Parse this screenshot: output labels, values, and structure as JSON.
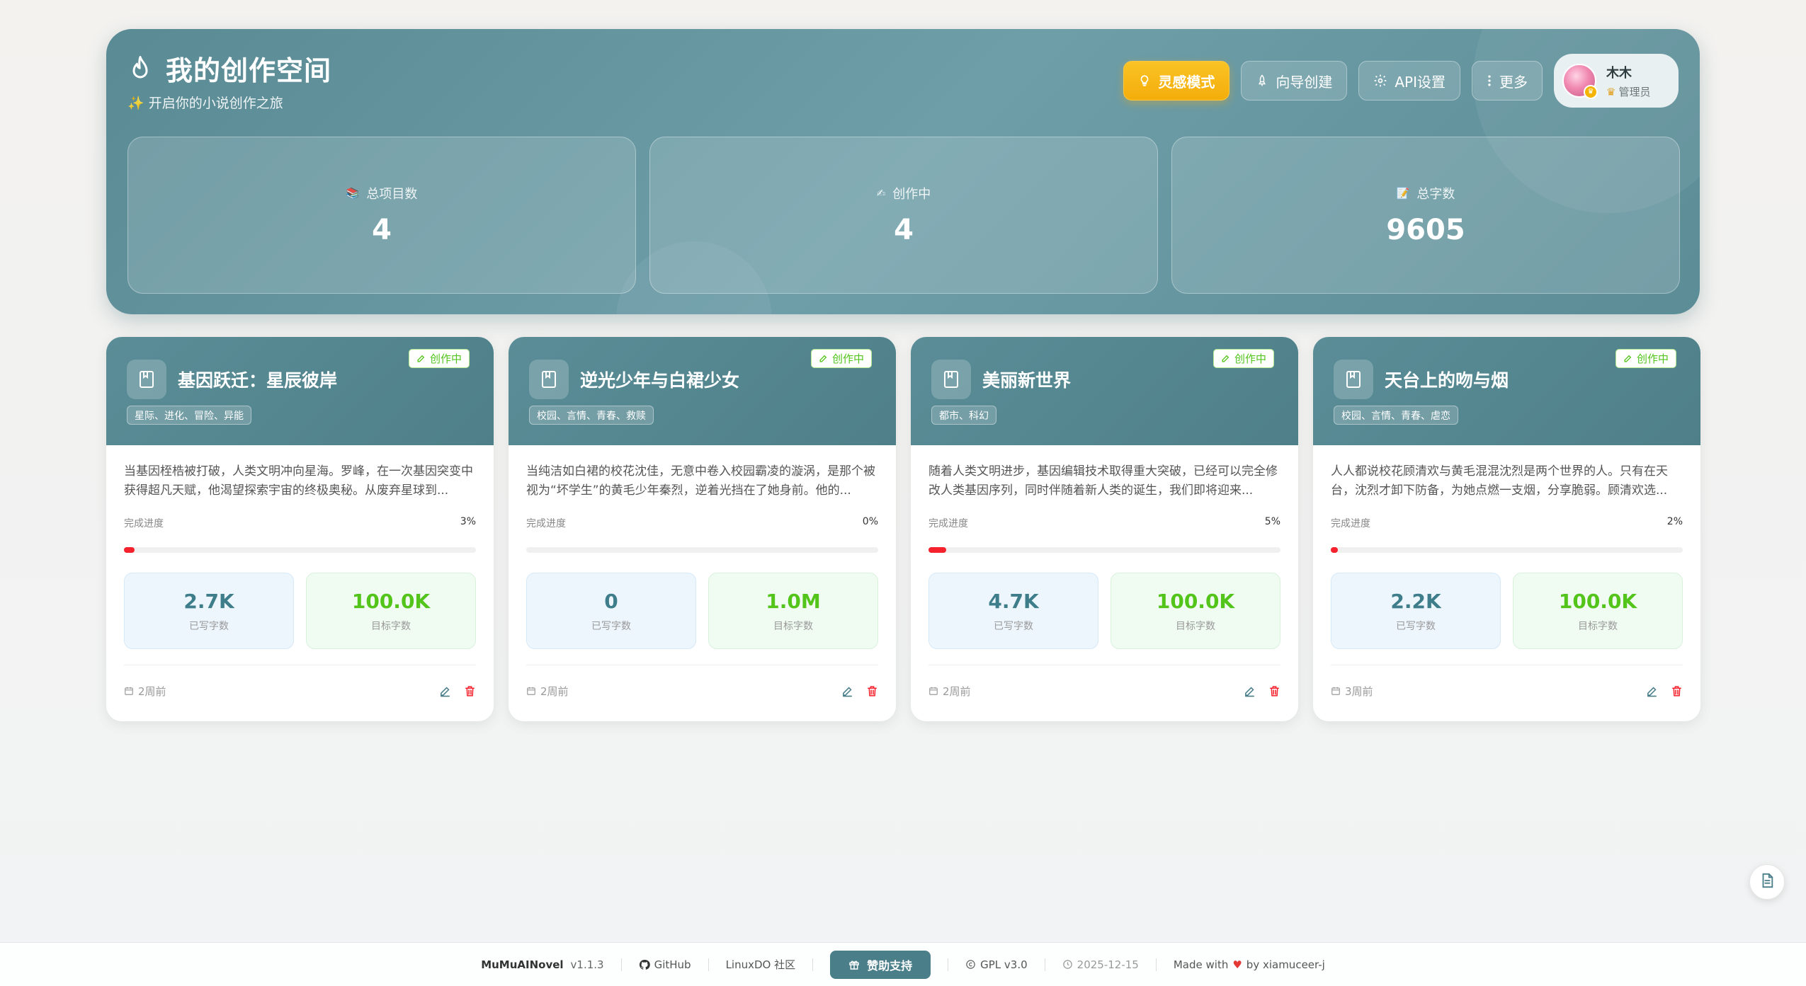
{
  "header": {
    "title": "我的创作空间",
    "subtitle": "✨ 开启你的小说创作之旅",
    "buttons": {
      "inspiration": "灵感模式",
      "wizard": "向导创建",
      "api": "API设置",
      "more": "更多"
    },
    "user": {
      "name": "木木",
      "role": "管理员"
    },
    "stats": [
      {
        "label": "总项目数",
        "value": "4"
      },
      {
        "label": "创作中",
        "value": "4"
      },
      {
        "label": "总字数",
        "value": "9605"
      }
    ]
  },
  "projects": [
    {
      "status": "创作中",
      "title": "基因跃迁：星辰彼岸",
      "tags": "星际、进化、冒险、异能",
      "desc": "当基因桎梏被打破，人类文明冲向星海。罗峰，在一次基因突变中获得超凡天赋，他渴望探索宇宙的终极奥秘。从废弃星球到...",
      "progress_label": "完成进度",
      "progress_pct": "3%",
      "progress": 0.03,
      "written": "2.7K",
      "written_label": "已写字数",
      "target": "100.0K",
      "target_label": "目标字数",
      "updated": "2周前"
    },
    {
      "status": "创作中",
      "title": "逆光少年与白裙少女",
      "tags": "校园、言情、青春、救赎",
      "desc": "当纯洁如白裙的校花沈佳，无意中卷入校园霸凌的漩涡，是那个被视为“坏学生”的黄毛少年秦烈，逆着光挡在了她身前。他的...",
      "progress_label": "完成进度",
      "progress_pct": "0%",
      "progress": 0.0,
      "written": "0",
      "written_label": "已写字数",
      "target": "1.0M",
      "target_label": "目标字数",
      "updated": "2周前"
    },
    {
      "status": "创作中",
      "title": "美丽新世界",
      "tags": "都市、科幻",
      "desc": "随着人类文明进步，基因编辑技术取得重大突破，已经可以完全修改人类基因序列，同时伴随着新人类的诞生，我们即将迎来...",
      "progress_label": "完成进度",
      "progress_pct": "5%",
      "progress": 0.05,
      "written": "4.7K",
      "written_label": "已写字数",
      "target": "100.0K",
      "target_label": "目标字数",
      "updated": "2周前"
    },
    {
      "status": "创作中",
      "title": "天台上的吻与烟",
      "tags": "校园、言情、青春、虐恋",
      "desc": "人人都说校花顾清欢与黄毛混混沈烈是两个世界的人。只有在天台，沈烈才卸下防备，为她点燃一支烟，分享脆弱。顾清欢选...",
      "progress_label": "完成进度",
      "progress_pct": "2%",
      "progress": 0.02,
      "written": "2.2K",
      "written_label": "已写字数",
      "target": "100.0K",
      "target_label": "目标字数",
      "updated": "3周前"
    }
  ],
  "footer": {
    "brand": "MuMuAINovel",
    "version": "v1.1.3",
    "github": "GitHub",
    "community": "LinuxDO 社区",
    "sponsor": "赞助支持",
    "license": "GPL v3.0",
    "date": "2025-12-15",
    "made_with": "Made with",
    "by": "by xiamuceer-j"
  },
  "colors": {
    "header_bg": "#5a8b95",
    "accent_gold": "#f4ad0a",
    "status_green": "#52c41a",
    "progress_red": "#f5222d",
    "sponsor_bg": "#4a7f8a"
  }
}
